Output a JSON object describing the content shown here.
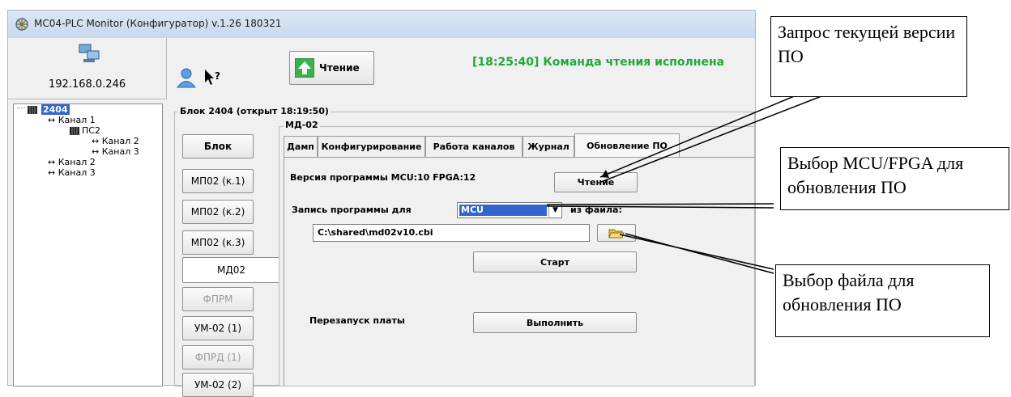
{
  "window": {
    "title": "MC04-PLC Monitor (Конфигуратор) v.1.26 180321",
    "ip": "192.168.0.246",
    "read_button": "Чтение",
    "status": "[18:25:40] Команда чтения исполнена"
  },
  "tree": {
    "root": "2404",
    "items": [
      "Канал 1",
      "ПС2",
      "Канал 2",
      "Канал 3",
      "Канал 2",
      "Канал 3"
    ]
  },
  "block": {
    "header": "Блок 2404 (открыт 18:19:50)",
    "side_buttons": [
      "Блок",
      "МП02 (к.1)",
      "МП02 (к.2)",
      "МП02 (к.3)",
      "МД02",
      "ФПРМ",
      "УМ-02 (1)",
      "ФПРД (1)",
      "УМ-02 (2)"
    ]
  },
  "panel": {
    "group_title": "МД-02",
    "tabs": [
      "Дамп",
      "Конфигурирование",
      "Работа каналов",
      "Журнал",
      "Обновление ПО"
    ],
    "version_text": "Версия программы MCU:10  FPGA:12",
    "version_read_button": "Чтение",
    "write_label": "Запись программы для",
    "target_select": "MCU",
    "from_file_label": "из файла:",
    "file_path": "C:\\shared\\md02v10.cbi",
    "start_button": "Старт",
    "restart_label": "Перезапуск платы",
    "execute_button": "Выполнить"
  },
  "callouts": {
    "version_request": "Запрос текущей версии ПО",
    "select_target": "Выбор MCU/FPGA для обновления ПО",
    "select_file": "Выбор файла для обновления ПО"
  }
}
